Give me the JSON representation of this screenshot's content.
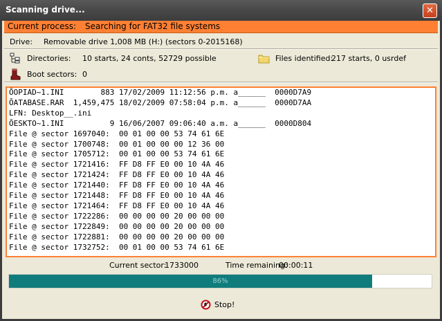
{
  "window": {
    "title": "Scanning drive..."
  },
  "process": {
    "label": "Current process:",
    "value": "Searching for FAT32 file systems"
  },
  "drive": {
    "label": "Drive:",
    "value": "Removable drive 1,008 MB (H:) (sectors 0-2015168)"
  },
  "directories": {
    "label": "Directories:",
    "value": "10 starts, 24 conts, 52729 possible"
  },
  "files_identified": {
    "label": "Files identified:",
    "value": "217 starts, 0 usrdef"
  },
  "boot_sectors": {
    "label": "Boot sectors:",
    "value": "0"
  },
  "log": [
    "ÕOPIAD~1.INI        883 17/02/2009 11:12:56 p.m. a______  0000D7A9",
    "ÕATABASE.RAR  1,459,475 18/02/2009 07:58:04 p.m. a______  0000D7AA",
    "LFN: Desktop__.ini",
    "ÕESKTO~1.INI          9 16/06/2007 09:06:40 a.m. a______  0000D804",
    "File @ sector 1697040:  00 01 00 00 53 74 61 6E",
    "File @ sector 1700748:  00 01 00 00 00 12 36 00",
    "File @ sector 1705712:  00 01 00 00 53 74 61 6E",
    "File @ sector 1721416:  FF D8 FF E0 00 10 4A 46",
    "File @ sector 1721424:  FF D8 FF E0 00 10 4A 46",
    "File @ sector 1721440:  FF D8 FF E0 00 10 4A 46",
    "File @ sector 1721448:  FF D8 FF E0 00 10 4A 46",
    "File @ sector 1721464:  FF D8 FF E0 00 10 4A 46",
    "File @ sector 1722286:  00 00 00 00 20 00 00 00",
    "File @ sector 1722849:  00 00 00 00 20 00 00 00",
    "File @ sector 1722881:  00 00 00 00 20 00 00 00",
    "File @ sector 1732752:  00 01 00 00 53 74 61 6E"
  ],
  "status": {
    "current_sector_label": "Current sector:",
    "current_sector_value": "1733000",
    "time_remaining_label": "Time remaining:",
    "time_remaining_value": "00:00:11"
  },
  "progress": {
    "fraction": 0.86,
    "text": "86%"
  },
  "stop_button": {
    "label": "Stop!"
  },
  "colors": {
    "accent": "#ff8033",
    "progress": "#117c7c"
  },
  "icons": {
    "close": "close-icon",
    "directories": "directory-tree-icon",
    "files": "folder-icon",
    "boot": "boot-icon",
    "stop": "stop-icon"
  }
}
